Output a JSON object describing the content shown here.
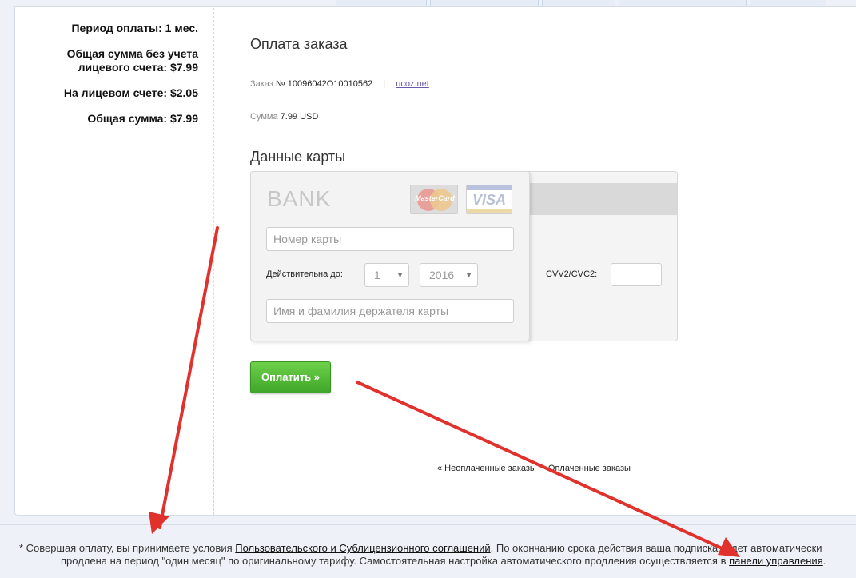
{
  "summary": {
    "period": "Период оплаты: 1 мес.",
    "total_without_account_line1": "Общая сумма без учета",
    "total_without_account_line2": "лицевого счета: $7.99",
    "on_account": "На лицевом счете: $2.05",
    "total": "Общая сумма: $7.99"
  },
  "order": {
    "title": "Оплата заказа",
    "order_label": "Заказ",
    "order_number": "№ 10096042O10010562",
    "separator": "|",
    "merchant_link": "ucoz.net",
    "sum_label": "Сумма",
    "sum_value": "7.99 USD"
  },
  "card": {
    "section_title": "Данные карты",
    "bank_text": "BANK",
    "mastercard_logo_text": "MasterCard",
    "visa_logo_text": "VISA",
    "card_number_placeholder": "Номер карты",
    "valid_label": "Действительна до:",
    "month_value": "1",
    "year_value": "2016",
    "holder_placeholder": "Имя и фамилия держателя карты",
    "cvv_label": "CVV2/CVC2:",
    "cvv_value": ""
  },
  "pay_button": "Оплатить »",
  "links": {
    "unpaid": "« Неоплаченные заказы",
    "paid": "Оплаченные заказы"
  },
  "footer": {
    "line1_prefix": "* Совершая оплату, вы принимаете условия ",
    "line1_link": "Пользовательского и Сублицензионного соглашений",
    "line1_suffix": ". По окончанию срока действия ваша подписка будет автоматически",
    "line2_prefix": "продлена на период \"один месяц\" по оригинальному тарифу. Самостоятельная настройка автоматического продления осуществляется в ",
    "line2_link": "панели управления",
    "line2_suffix": "."
  },
  "colors": {
    "pay_button": "#4db236",
    "annotation_arrow": "#e0312c",
    "link": "#6a5aa8"
  },
  "icons": {
    "mastercard": "mastercard-logo",
    "visa": "visa-logo",
    "select_arrow": "chevron-down-icon"
  }
}
